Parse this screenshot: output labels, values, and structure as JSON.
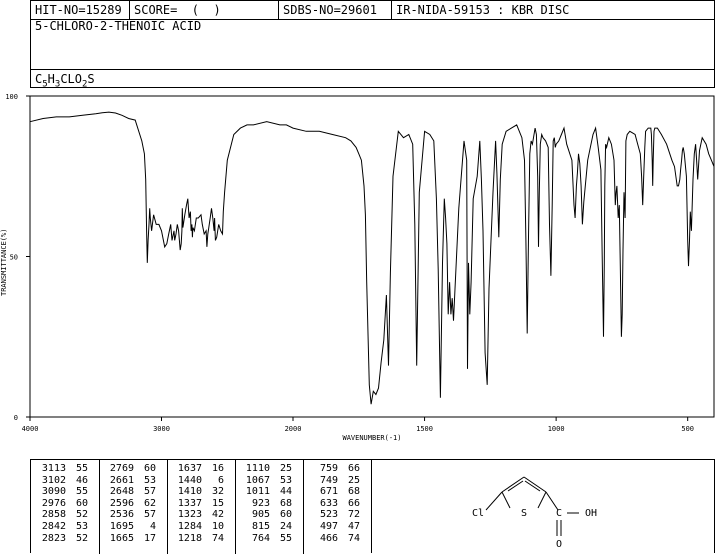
{
  "header": {
    "hit_no": "HIT-NO=15289",
    "score": "SCORE=  (  )",
    "sdbs_no": "SDBS-NO=29601",
    "ir": "IR-NIDA-59153 : KBR DISC",
    "compound_name": "5-CHLORO-2-THENOIC ACID",
    "formula": {
      "c": "C",
      "c_n": "5",
      "h": "H",
      "h_n": "3",
      "rest": "CLO",
      "o_n": "2",
      "s": "S"
    }
  },
  "chart_data": {
    "type": "line",
    "title": "",
    "xlabel": "WAVENUMBER(-1)",
    "ylabel": "TRANSMITTANCE(%)",
    "xlim": [
      4000,
      400
    ],
    "ylim": [
      0,
      100
    ],
    "x_ticks": [
      4000,
      3000,
      2000,
      1500,
      1000,
      500
    ],
    "y_ticks": [
      100,
      50,
      0
    ],
    "series": [
      {
        "x": [
          4000,
          3900,
          3800,
          3700,
          3600,
          3500,
          3450,
          3400,
          3350,
          3300,
          3250,
          3200,
          3150,
          3130,
          3120,
          3113,
          3108,
          3102,
          3095,
          3090,
          3085,
          3075,
          3060,
          3040,
          3020,
          3000,
          2976,
          2960,
          2945,
          2930,
          2920,
          2905,
          2900,
          2890,
          2880,
          2870,
          2858,
          2850,
          2845,
          2842,
          2837,
          2823,
          2810,
          2800,
          2790,
          2780,
          2775,
          2769,
          2765,
          2761,
          2750,
          2735,
          2720,
          2700,
          2690,
          2675,
          2661,
          2655,
          2648,
          2640,
          2630,
          2620,
          2610,
          2600,
          2596,
          2590,
          2580,
          2565,
          2550,
          2536,
          2530,
          2520,
          2500,
          2450,
          2400,
          2350,
          2300,
          2200,
          2100,
          2050,
          2000,
          1950,
          1900,
          1850,
          1800,
          1780,
          1760,
          1750,
          1740,
          1730,
          1725,
          1720,
          1710,
          1703,
          1695,
          1685,
          1675,
          1665,
          1655,
          1645,
          1637,
          1630,
          1620,
          1600,
          1580,
          1560,
          1545,
          1537,
          1530,
          1520,
          1500,
          1480,
          1465,
          1455,
          1448,
          1440,
          1432,
          1425,
          1420,
          1415,
          1410,
          1405,
          1400,
          1395,
          1390,
          1370,
          1350,
          1340,
          1337,
          1333,
          1328,
          1323,
          1315,
          1300,
          1290,
          1284,
          1278,
          1270,
          1262,
          1255,
          1240,
          1230,
          1225,
          1218,
          1212,
          1205,
          1190,
          1170,
          1150,
          1130,
          1120,
          1115,
          1110,
          1105,
          1100,
          1095,
          1090,
          1080,
          1075,
          1070,
          1067,
          1064,
          1060,
          1055,
          1050,
          1040,
          1030,
          1025,
          1020,
          1015,
          1011,
          1007,
          1003,
          1000,
          990,
          980,
          970,
          960,
          940,
          932,
          928,
          923,
          919,
          915,
          910,
          905,
          900,
          895,
          880,
          860,
          850,
          840,
          830,
          825,
          820,
          817,
          815,
          812,
          808,
          800,
          790,
          780,
          775,
          772,
          769,
          764,
          760,
          756,
          752,
          749,
          746,
          742,
          738,
          735,
          730,
          720,
          700,
          690,
          680,
          675,
          671,
          667,
          663,
          660,
          650,
          640,
          638,
          635,
          633,
          631,
          628,
          625,
          615,
          600,
          580,
          560,
          550,
          540,
          535,
          530,
          527,
          523,
          520,
          517,
          513,
          505,
          500,
          497,
          493,
          490,
          486,
          480,
          475,
          470,
          466,
          462,
          455,
          445,
          430,
          420,
          410,
          400
        ],
        "y": [
          92,
          93,
          93.5,
          93.5,
          94,
          94.5,
          94.8,
          95,
          94.7,
          94,
          93,
          92.5,
          86,
          82,
          74,
          58,
          48,
          55,
          60,
          65,
          62,
          58,
          63,
          60,
          60,
          58,
          53,
          54,
          57,
          60,
          55,
          58,
          55,
          57,
          60,
          58,
          52,
          54,
          58,
          65,
          59,
          63,
          66,
          68,
          62,
          64,
          58,
          60,
          56,
          59,
          58,
          62,
          62,
          63,
          60,
          57,
          58,
          53,
          57,
          59,
          62,
          65,
          62,
          58,
          62,
          55,
          56,
          60,
          58,
          57,
          64,
          70,
          80,
          88,
          90,
          91,
          91,
          92,
          91,
          91,
          90,
          89,
          89,
          88,
          87,
          86,
          84,
          82,
          80,
          72,
          63,
          42,
          10,
          4,
          8,
          7,
          9,
          17,
          24,
          38,
          16,
          45,
          75,
          89,
          87,
          88,
          85,
          60,
          16,
          70,
          89,
          88,
          86,
          68,
          46,
          6,
          48,
          68,
          62,
          54,
          32,
          42,
          32,
          37,
          30,
          65,
          86,
          80,
          15,
          48,
          32,
          42,
          68,
          75,
          86,
          74,
          58,
          20,
          10,
          40,
          70,
          86,
          76,
          56,
          74,
          85,
          89,
          90,
          91,
          87,
          80,
          55,
          26,
          56,
          82,
          86,
          85,
          90,
          88,
          75,
          53,
          70,
          85,
          88,
          87,
          86,
          84,
          60,
          44,
          66,
          86,
          87,
          84,
          85,
          86,
          88,
          90,
          85,
          80,
          66,
          62,
          72,
          76,
          82,
          79,
          72,
          60,
          67,
          80,
          88,
          90,
          84,
          77,
          50,
          25,
          48,
          72,
          85,
          84,
          87,
          85,
          80,
          66,
          70,
          72,
          62,
          66,
          47,
          25,
          32,
          52,
          70,
          62,
          86,
          88,
          89,
          88,
          85,
          82,
          75,
          66,
          75,
          84,
          89,
          90,
          90,
          88,
          80,
          72,
          80,
          89,
          90,
          90,
          88,
          85,
          80,
          78,
          72,
          72,
          74,
          77,
          80,
          83,
          84,
          82,
          75,
          55,
          47,
          55,
          64,
          58,
          74,
          82,
          85,
          80,
          74,
          83,
          87,
          85,
          82,
          80,
          78
        ]
      }
    ]
  },
  "peaks": {
    "columns": [
      {
        "wn": [
          "3113",
          "3102",
          "3090",
          "2976",
          "2858",
          "2842",
          "2823"
        ],
        "t": [
          "55",
          "46",
          "55",
          "60",
          "52",
          "53",
          "52"
        ]
      },
      {
        "wn": [
          "2769",
          "2661",
          "2648",
          "2596",
          "2536",
          "1695",
          "1665"
        ],
        "t": [
          "60",
          "53",
          "57",
          "62",
          "57",
          "4",
          "17"
        ]
      },
      {
        "wn": [
          "1637",
          "1440",
          "1410",
          "1337",
          "1323",
          "1284",
          "1218"
        ],
        "t": [
          "16",
          "6",
          "32",
          "15",
          "42",
          "10",
          "74"
        ]
      },
      {
        "wn": [
          "1110",
          "1067",
          "1011",
          "923",
          "905",
          "815",
          "764"
        ],
        "t": [
          "25",
          "53",
          "44",
          "68",
          "60",
          "24",
          "55"
        ]
      },
      {
        "wn": [
          "759",
          "749",
          "671",
          "633",
          "523",
          "497",
          "466"
        ],
        "t": [
          "66",
          "25",
          "68",
          "66",
          "72",
          "47",
          "74"
        ]
      }
    ]
  },
  "structure": {
    "cl_label": "Cl",
    "s_label": "S",
    "o_label": "O",
    "oh_label": "OH",
    "c_label": "C"
  }
}
